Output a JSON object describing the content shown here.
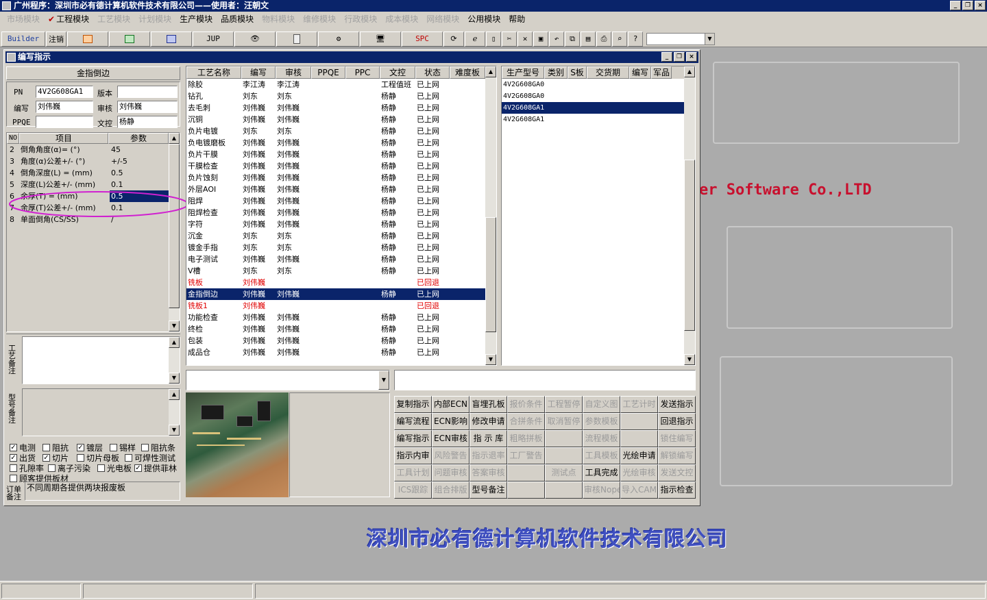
{
  "app": {
    "title": "广州程序：深圳市必有德计算机软件技术有限公司——使用者：汪朝文"
  },
  "menu": [
    {
      "label": "市场模块",
      "enabled": false
    },
    {
      "label": "工程模块",
      "enabled": true,
      "checked": true
    },
    {
      "label": "工艺模块",
      "enabled": false
    },
    {
      "label": "计划模块",
      "enabled": false
    },
    {
      "label": "生产模块",
      "enabled": true
    },
    {
      "label": "品质模块",
      "enabled": true
    },
    {
      "label": "物料模块",
      "enabled": false
    },
    {
      "label": "维修模块",
      "enabled": false
    },
    {
      "label": "行政模块",
      "enabled": false
    },
    {
      "label": "成本模块",
      "enabled": false
    },
    {
      "label": "网络模块",
      "enabled": false
    },
    {
      "label": "公用模块",
      "enabled": true
    },
    {
      "label": "帮助",
      "enabled": true
    }
  ],
  "toolbar": {
    "builder": "Builder",
    "logout": "注销",
    "jup": "JUP",
    "spc": "SPC"
  },
  "background": {
    "company_en": "er Software Co.,LTD",
    "company_cn": "深圳市必有德计算机软件技术有限公司"
  },
  "colors": {
    "title_bar": "#0a246a",
    "selected": "#0a246a",
    "rejected": "#e00000",
    "annotation": "#d020d0"
  },
  "window": {
    "title": "编写指示",
    "left": {
      "header": "金指倒边",
      "pn_label": "PN",
      "pn_value": "4V2G608GA1",
      "version_label": "版本",
      "version_value": "",
      "author_label": "编写",
      "author_value": "刘伟巍",
      "review_label": "审核",
      "review_value": "刘伟巍",
      "ppqe_label": "PPQE",
      "ppqe_value": "",
      "doc_label": "文控",
      "doc_value": "杨静",
      "param_cols": [
        "NO",
        "项目",
        "参数"
      ],
      "params": [
        {
          "no": "2",
          "item": "倒角角度(α)=  (°)",
          "value": "45"
        },
        {
          "no": "3",
          "item": "角度(α)公差+/-  (°)",
          "value": "+/-5"
        },
        {
          "no": "4",
          "item": "倒角深度(L) =  (mm)",
          "value": "0.5"
        },
        {
          "no": "5",
          "item": "深度(L)公差+/-  (mm)",
          "value": "0.1"
        },
        {
          "no": "6",
          "item": "余厚(T) =   (mm)",
          "value": "0.5"
        },
        {
          "no": "7",
          "item": "余厚(T)公差+/-  (mm)",
          "value": "0.1"
        },
        {
          "no": "8",
          "item": "单面倒角(CS/SS)",
          "value": "/"
        }
      ],
      "process_note_label": "工艺备注",
      "model_note_label": "型号备注",
      "checkboxes": [
        {
          "label": "电测",
          "checked": true
        },
        {
          "label": "阻抗",
          "checked": false
        },
        {
          "label": "镀层",
          "checked": true
        },
        {
          "label": "锡样",
          "checked": false
        },
        {
          "label": "阻抗条",
          "checked": false
        },
        {
          "label": "出货",
          "checked": true
        },
        {
          "label": "切片",
          "checked": true
        },
        {
          "label": "切片母板",
          "checked": false
        },
        {
          "label": "可焊性测试",
          "checked": false
        },
        {
          "label": "孔隙率",
          "checked": false
        },
        {
          "label": "离子污染",
          "checked": false
        },
        {
          "label": "光电板",
          "checked": false
        },
        {
          "label": "提供菲林",
          "checked": true
        },
        {
          "label": "顾客提供板材",
          "checked": false
        }
      ],
      "order_note_label": "订单备注",
      "order_note_value": "不同周期各提供两块报废板"
    },
    "process_cols": [
      "工艺名称",
      "编写",
      "审核",
      "PPQE",
      "PPC",
      "文控",
      "状态",
      "难度板"
    ],
    "processes": [
      {
        "name": "除胶",
        "author": "李江涛",
        "review": "李江涛",
        "doc": "工程值班",
        "status": "已上网"
      },
      {
        "name": "钻孔",
        "author": "刘东",
        "review": "刘东",
        "doc": "杨静",
        "status": "已上网"
      },
      {
        "name": "去毛刺",
        "author": "刘伟巍",
        "review": "刘伟巍",
        "doc": "杨静",
        "status": "已上网"
      },
      {
        "name": "沉铜",
        "author": "刘伟巍",
        "review": "刘伟巍",
        "doc": "杨静",
        "status": "已上网"
      },
      {
        "name": "负片电镀",
        "author": "刘东",
        "review": "刘东",
        "doc": "杨静",
        "status": "已上网"
      },
      {
        "name": "负电镀磨板",
        "author": "刘伟巍",
        "review": "刘伟巍",
        "doc": "杨静",
        "status": "已上网"
      },
      {
        "name": "负片干膜",
        "author": "刘伟巍",
        "review": "刘伟巍",
        "doc": "杨静",
        "status": "已上网"
      },
      {
        "name": "干膜检查",
        "author": "刘伟巍",
        "review": "刘伟巍",
        "doc": "杨静",
        "status": "已上网"
      },
      {
        "name": "负片蚀刻",
        "author": "刘伟巍",
        "review": "刘伟巍",
        "doc": "杨静",
        "status": "已上网"
      },
      {
        "name": "外层AOI",
        "author": "刘伟巍",
        "review": "刘伟巍",
        "doc": "杨静",
        "status": "已上网"
      },
      {
        "name": "阻焊",
        "author": "刘伟巍",
        "review": "刘伟巍",
        "doc": "杨静",
        "status": "已上网"
      },
      {
        "name": "阻焊检查",
        "author": "刘伟巍",
        "review": "刘伟巍",
        "doc": "杨静",
        "status": "已上网"
      },
      {
        "name": "字符",
        "author": "刘伟巍",
        "review": "刘伟巍",
        "doc": "杨静",
        "status": "已上网"
      },
      {
        "name": "沉金",
        "author": "刘东",
        "review": "刘东",
        "doc": "杨静",
        "status": "已上网"
      },
      {
        "name": "镀金手指",
        "author": "刘东",
        "review": "刘东",
        "doc": "杨静",
        "status": "已上网"
      },
      {
        "name": "电子测试",
        "author": "刘伟巍",
        "review": "刘伟巍",
        "doc": "杨静",
        "status": "已上网"
      },
      {
        "name": "V槽",
        "author": "刘东",
        "review": "刘东",
        "doc": "杨静",
        "status": "已上网"
      },
      {
        "name": "铣板",
        "author": "刘伟巍",
        "review": "",
        "doc": "",
        "status": "已回退",
        "rejected": true
      },
      {
        "name": "金指倒边",
        "author": "刘伟巍",
        "review": "刘伟巍",
        "doc": "杨静",
        "status": "已上网",
        "selected": true
      },
      {
        "name": "铣板1",
        "author": "刘伟巍",
        "review": "",
        "doc": "",
        "status": "已回退",
        "rejected": true
      },
      {
        "name": "功能检查",
        "author": "刘伟巍",
        "review": "刘伟巍",
        "doc": "杨静",
        "status": "已上网"
      },
      {
        "name": "终检",
        "author": "刘伟巍",
        "review": "刘伟巍",
        "doc": "杨静",
        "status": "已上网"
      },
      {
        "name": "包装",
        "author": "刘伟巍",
        "review": "刘伟巍",
        "doc": "杨静",
        "status": "已上网"
      },
      {
        "name": "成品仓",
        "author": "刘伟巍",
        "review": "刘伟巍",
        "doc": "杨静",
        "status": "已上网"
      }
    ],
    "model_cols": [
      "生产型号",
      "类别",
      "S板",
      "交货期",
      "编写",
      "军品"
    ],
    "models": [
      {
        "model": "4V2G608GA0",
        "selected": false
      },
      {
        "model": "4V2G608GA0",
        "selected": false
      },
      {
        "model": "4V2G608GA1",
        "selected": true
      },
      {
        "model": "4V2G608GA1",
        "selected": false
      }
    ],
    "buttons": [
      {
        "label": "复制指示",
        "enabled": true
      },
      {
        "label": "内部ECN",
        "enabled": true
      },
      {
        "label": "盲埋孔板",
        "enabled": true
      },
      {
        "label": "报价条件",
        "enabled": false
      },
      {
        "label": "工程暂停",
        "enabled": false
      },
      {
        "label": "自定义图",
        "enabled": false
      },
      {
        "label": "工艺计时",
        "enabled": false
      },
      {
        "label": "发送指示",
        "enabled": true
      },
      {
        "label": "编写流程",
        "enabled": true
      },
      {
        "label": "ECN影响",
        "enabled": true
      },
      {
        "label": "修改申请",
        "enabled": true
      },
      {
        "label": "合拼条件",
        "enabled": false
      },
      {
        "label": "取消暂停",
        "enabled": false
      },
      {
        "label": "参数模板",
        "enabled": false
      },
      {
        "label": "",
        "enabled": false
      },
      {
        "label": "回退指示",
        "enabled": true
      },
      {
        "label": "编写指示",
        "enabled": true
      },
      {
        "label": "ECN审核",
        "enabled": true
      },
      {
        "label": "指 示 库",
        "enabled": true
      },
      {
        "label": "粗略拼板",
        "enabled": false
      },
      {
        "label": "",
        "enabled": false
      },
      {
        "label": "流程模板",
        "enabled": false
      },
      {
        "label": "",
        "enabled": false
      },
      {
        "label": "锁住编写",
        "enabled": false
      },
      {
        "label": "指示内审",
        "enabled": true
      },
      {
        "label": "风险警告",
        "enabled": false
      },
      {
        "label": "指示退率",
        "enabled": false
      },
      {
        "label": "工厂警告",
        "enabled": false
      },
      {
        "label": "",
        "enabled": false
      },
      {
        "label": "工具模板",
        "enabled": false
      },
      {
        "label": "光绘申请",
        "enabled": true
      },
      {
        "label": "解锁编写",
        "enabled": false
      },
      {
        "label": "工具计划",
        "enabled": false
      },
      {
        "label": "问题审核",
        "enabled": false
      },
      {
        "label": "答案审核",
        "enabled": false
      },
      {
        "label": "",
        "enabled": false
      },
      {
        "label": "测试点",
        "enabled": false
      },
      {
        "label": "工具完成",
        "enabled": true
      },
      {
        "label": "光绘审核",
        "enabled": false
      },
      {
        "label": "发送文控",
        "enabled": false
      },
      {
        "label": "ICS跟踪",
        "enabled": false
      },
      {
        "label": "组合排版",
        "enabled": false
      },
      {
        "label": "型号备注",
        "enabled": true
      },
      {
        "label": "",
        "enabled": false
      },
      {
        "label": "",
        "enabled": false
      },
      {
        "label": "审核Nope",
        "enabled": false
      },
      {
        "label": "导入CAM",
        "enabled": false
      },
      {
        "label": "指示检查",
        "enabled": true
      }
    ]
  }
}
